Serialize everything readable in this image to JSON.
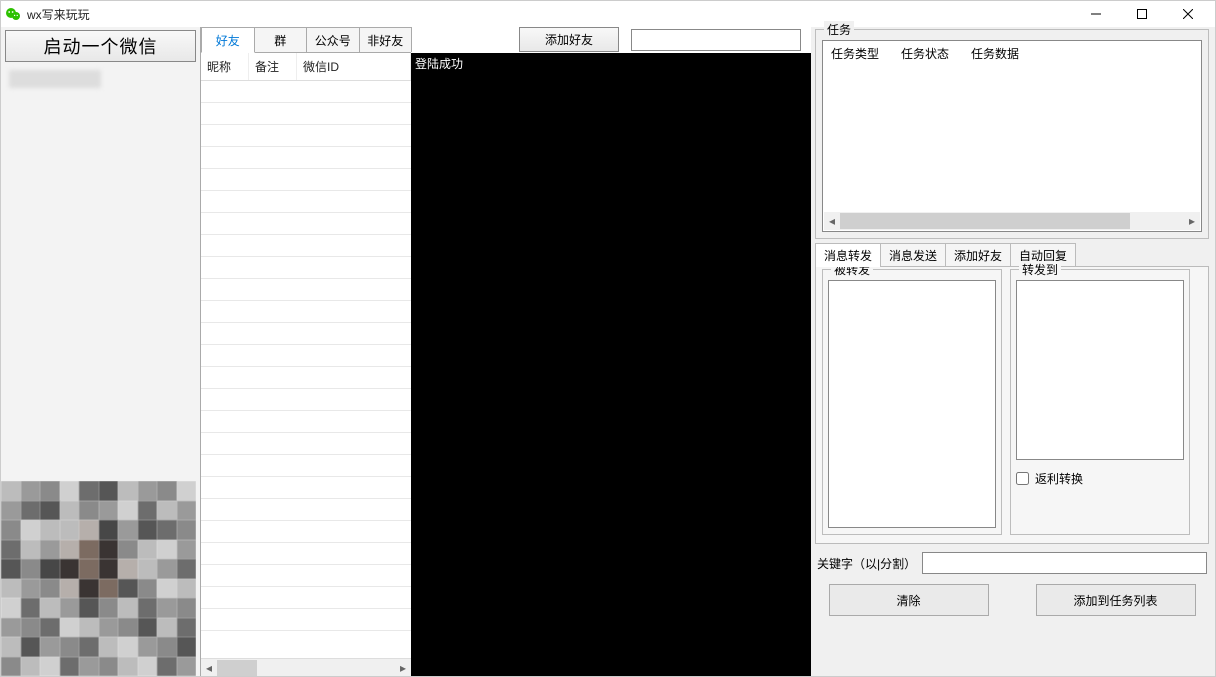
{
  "window": {
    "title": "wx写来玩玩"
  },
  "left": {
    "start_button": "启动一个微信",
    "account_placeholder": ""
  },
  "contacts": {
    "tabs": [
      "好友",
      "群",
      "公众号",
      "非好友"
    ],
    "active_tab_index": 0,
    "columns": {
      "nickname": "昵称",
      "remark": "备注",
      "wxid": "微信ID"
    }
  },
  "center": {
    "add_friend_button": "添加好友",
    "search_placeholder": "",
    "chat_log": [
      "登陆成功"
    ]
  },
  "tasks": {
    "group_label": "任务",
    "columns": {
      "type": "任务类型",
      "status": "任务状态",
      "data": "任务数据"
    }
  },
  "ops": {
    "tabs": [
      "消息转发",
      "消息发送",
      "添加好友",
      "自动回复"
    ],
    "active_tab_index": 0,
    "forward": {
      "source_label": "被转发",
      "target_label": "转发到",
      "rebate_checkbox": "返利转换"
    },
    "keyword_label": "关键字（以|分割）",
    "keyword_value": "",
    "clear_button": "清除",
    "add_task_button": "添加到任务列表"
  }
}
